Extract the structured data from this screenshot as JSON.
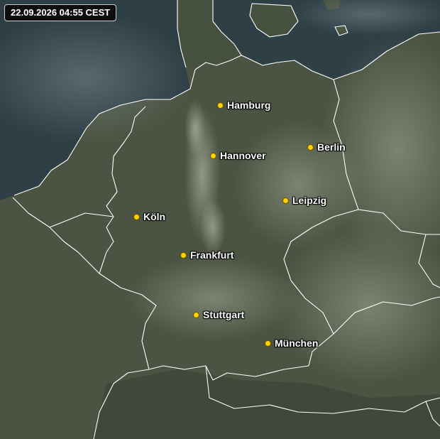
{
  "timestamp": "22.09.2026 04:55 CEST",
  "colors": {
    "sea": "#2f3f46",
    "land": "#4b5442",
    "land_light": "#7b8470",
    "cloud": "#c9cfc2",
    "border": "#ffffff",
    "city_dot": "#ffd200"
  },
  "cities": [
    {
      "id": "hamburg",
      "name": "Hamburg"
    },
    {
      "id": "hannover",
      "name": "Hannover"
    },
    {
      "id": "berlin",
      "name": "Berlin"
    },
    {
      "id": "leipzig",
      "name": "Leipzig"
    },
    {
      "id": "koeln",
      "name": "Köln"
    },
    {
      "id": "frankfurt",
      "name": "Frankfurt"
    },
    {
      "id": "stuttgart",
      "name": "Stuttgart"
    },
    {
      "id": "muenchen",
      "name": "München"
    }
  ]
}
